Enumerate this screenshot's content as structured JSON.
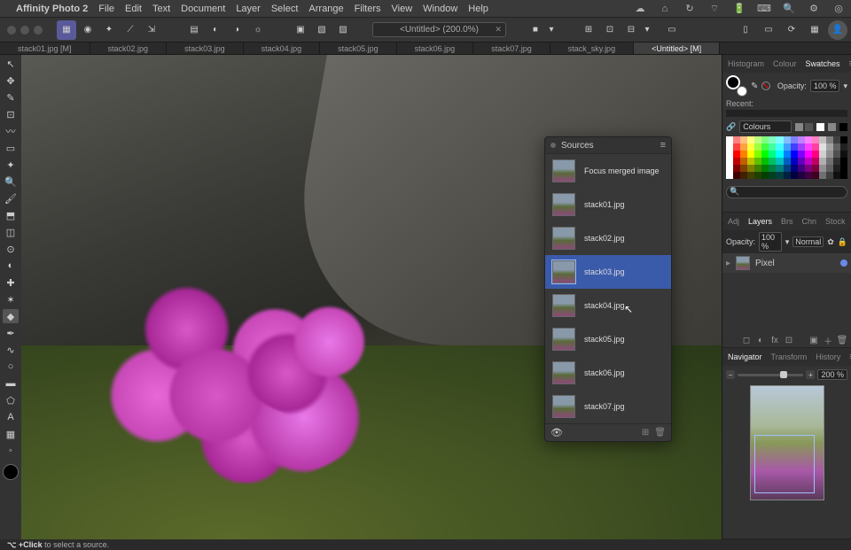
{
  "menubar": {
    "app": "Affinity Photo 2",
    "items": [
      "File",
      "Edit",
      "Text",
      "Document",
      "Layer",
      "Select",
      "Arrange",
      "Filters",
      "View",
      "Window",
      "Help"
    ]
  },
  "toolbar": {
    "doc_title": "<Untitled> (200.0%)"
  },
  "tabs": [
    {
      "label": "stack01.jpg [M]",
      "active": false
    },
    {
      "label": "stack02.jpg",
      "active": false
    },
    {
      "label": "stack03.jpg",
      "active": false
    },
    {
      "label": "stack04.jpg",
      "active": false
    },
    {
      "label": "stack05.jpg",
      "active": false
    },
    {
      "label": "stack06.jpg",
      "active": false
    },
    {
      "label": "stack07.jpg",
      "active": false
    },
    {
      "label": "stack_sky.jpg",
      "active": false
    },
    {
      "label": "<Untitled> [M]",
      "active": true
    }
  ],
  "sources": {
    "title": "Sources",
    "items": [
      {
        "label": "Focus merged image",
        "selected": false
      },
      {
        "label": "stack01.jpg",
        "selected": false
      },
      {
        "label": "stack02.jpg",
        "selected": false
      },
      {
        "label": "stack03.jpg",
        "selected": true
      },
      {
        "label": "stack04.jpg",
        "selected": false
      },
      {
        "label": "stack05.jpg",
        "selected": false
      },
      {
        "label": "stack06.jpg",
        "selected": false
      },
      {
        "label": "stack07.jpg",
        "selected": false
      }
    ]
  },
  "colour_panel": {
    "tabs": [
      "Histogram",
      "Colour",
      "Swatches"
    ],
    "active_tab": "Swatches",
    "opacity_label": "Opacity:",
    "opacity_value": "100 %",
    "recent_label": "Recent:",
    "palette_label": "Colours"
  },
  "layers_panel": {
    "tabs": [
      "Adj",
      "Layers",
      "Brs",
      "Chn",
      "Stock"
    ],
    "active_tab": "Layers",
    "opacity_label": "Opacity:",
    "opacity_value": "100 %",
    "blend_mode": "Normal",
    "layer_name": "Pixel"
  },
  "navigator": {
    "tabs": [
      "Navigator",
      "Transform",
      "History"
    ],
    "active_tab": "Navigator",
    "zoom_value": "200 %"
  },
  "status": {
    "hint_prefix": "⌥ +Click",
    "hint_rest": " to select a source."
  },
  "search_placeholder": "",
  "swatch_colors": [
    "#ffffff",
    "#ff8080",
    "#ffc080",
    "#ffff80",
    "#c0ff80",
    "#80ff80",
    "#80ffc0",
    "#80ffff",
    "#80c0ff",
    "#8080ff",
    "#c080ff",
    "#ff80ff",
    "#ff80c0",
    "#c0c0c0",
    "#808080",
    "#404040",
    "#000000",
    "#ffffff",
    "#ff4040",
    "#ffa040",
    "#ffff40",
    "#a0ff40",
    "#40ff40",
    "#40ffa0",
    "#40ffff",
    "#40a0ff",
    "#4040ff",
    "#a040ff",
    "#ff40ff",
    "#ff40a0",
    "#e0e0e0",
    "#a0a0a0",
    "#606060",
    "#202020",
    "#ffffff",
    "#ff0000",
    "#ff8000",
    "#ffff00",
    "#80ff00",
    "#00ff00",
    "#00ff80",
    "#00ffff",
    "#0080ff",
    "#0000ff",
    "#8000ff",
    "#ff00ff",
    "#ff0080",
    "#d0d0d0",
    "#909090",
    "#505050",
    "#101010",
    "#ffffff",
    "#c00000",
    "#c06000",
    "#c0c000",
    "#60c000",
    "#00c000",
    "#00c060",
    "#00c0c0",
    "#0060c0",
    "#0000c0",
    "#6000c0",
    "#c000c0",
    "#c00060",
    "#b0b0b0",
    "#707070",
    "#303030",
    "#000000",
    "#ffffff",
    "#800000",
    "#804000",
    "#808000",
    "#408000",
    "#008000",
    "#008040",
    "#008080",
    "#004080",
    "#000080",
    "#400080",
    "#800080",
    "#800040",
    "#909090",
    "#606060",
    "#202020",
    "#000000",
    "#ffffff",
    "#400000",
    "#402000",
    "#404000",
    "#204000",
    "#004000",
    "#004020",
    "#004040",
    "#002040",
    "#000040",
    "#200040",
    "#400040",
    "#400020",
    "#707070",
    "#404040",
    "#101010",
    "#000000"
  ]
}
